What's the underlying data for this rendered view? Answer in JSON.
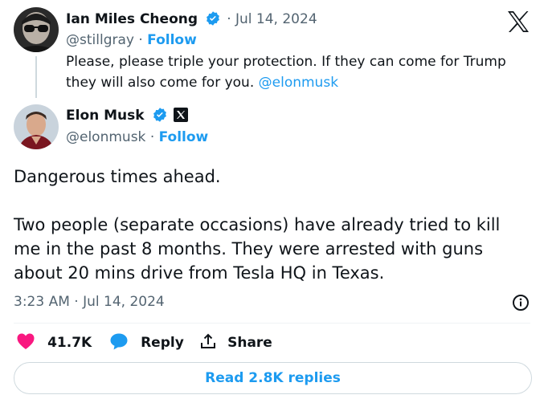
{
  "x_logo": "x-logo-icon",
  "quoted": {
    "author_name": "Ian Miles Cheong",
    "date": "· Jul 14, 2024",
    "handle": "@stillgray",
    "sep": "·",
    "follow": "Follow",
    "text": "Please, please triple your protection. If they can come for Trump they will also come for you. ",
    "mention": "@elonmusk"
  },
  "post": {
    "author_name": "Elon Musk",
    "handle": "@elonmusk",
    "sep": "·",
    "follow": "Follow",
    "line1": "Dangerous times ahead.",
    "line2": "Two people (separate occasions) have already tried to kill me in the past 8 months. They were arrested with guns about 20 mins drive from Tesla HQ in Texas.",
    "timestamp": "3:23 AM · Jul 14, 2024"
  },
  "actions": {
    "likes": "41.7K",
    "reply": "Reply",
    "share": "Share"
  },
  "read_replies": "Read 2.8K replies",
  "colors": {
    "accent": "#1d9bf0",
    "like": "#f91880",
    "text": "#0f1419",
    "muted": "#536471",
    "border": "#cfd9de"
  }
}
